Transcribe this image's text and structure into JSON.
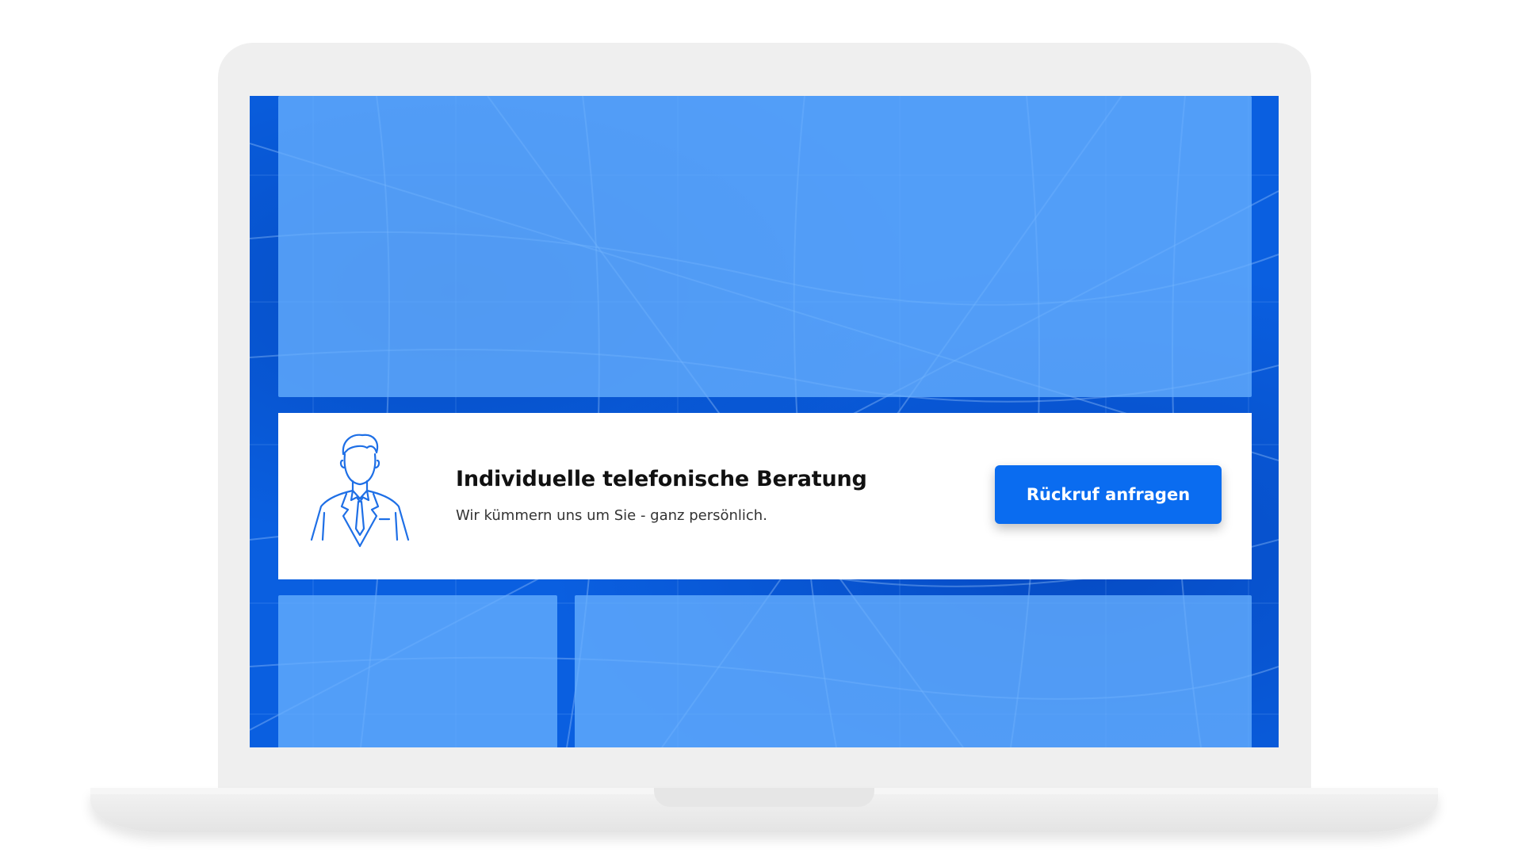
{
  "cta": {
    "title": "Individuelle telefonische Beratung",
    "subtitle": "Wir kümmern uns um Sie - ganz persönlich.",
    "button_label": "Rückruf anfragen",
    "icon": "businessman-icon"
  },
  "colors": {
    "brand_blue": "#0a6cf0",
    "screen_background": "#0a5fe0",
    "panel_overlay": "#66b0ff",
    "card_background": "#ffffff",
    "laptop_frame": "#efefef"
  }
}
